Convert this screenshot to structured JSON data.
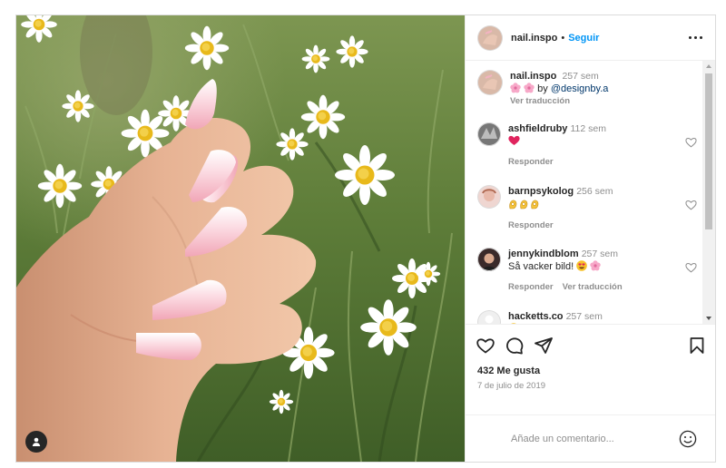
{
  "post": {
    "author": "nail.inspo",
    "follow_label": "Seguir",
    "separator": "•",
    "caption_time": "257 sem",
    "caption_by": "by",
    "caption_mention": "@designby.a",
    "see_translation": "Ver traducción"
  },
  "comments": [
    {
      "user": "ashfieldruby",
      "time": "112 sem",
      "text": "",
      "emoji": [
        "red-heart"
      ],
      "reply": "Responder",
      "translate": ""
    },
    {
      "user": "barnpsykolog",
      "time": "256 sem",
      "text": "",
      "emoji": [
        "ok-hand",
        "ok-hand",
        "ok-hand"
      ],
      "reply": "Responder",
      "translate": ""
    },
    {
      "user": "jennykindblom",
      "time": "257 sem",
      "text": "Så vacker bild!",
      "emoji": [
        "heart-eyes",
        "cherry-blossom"
      ],
      "reply": "Responder",
      "translate": "Ver traducción"
    },
    {
      "user": "hacketts.co",
      "time": "257 sem",
      "text": "",
      "emoji": [
        "heart-eyes"
      ],
      "reply": "",
      "translate": ""
    }
  ],
  "likes": "432 Me gusta",
  "date": "7 de julio de 2019",
  "add_comment": {
    "placeholder": "Añade un comentario..."
  },
  "colors": {
    "link": "#0095f6",
    "muted": "#8e8e8e",
    "text": "#262626",
    "border": "#dbdbdb"
  }
}
